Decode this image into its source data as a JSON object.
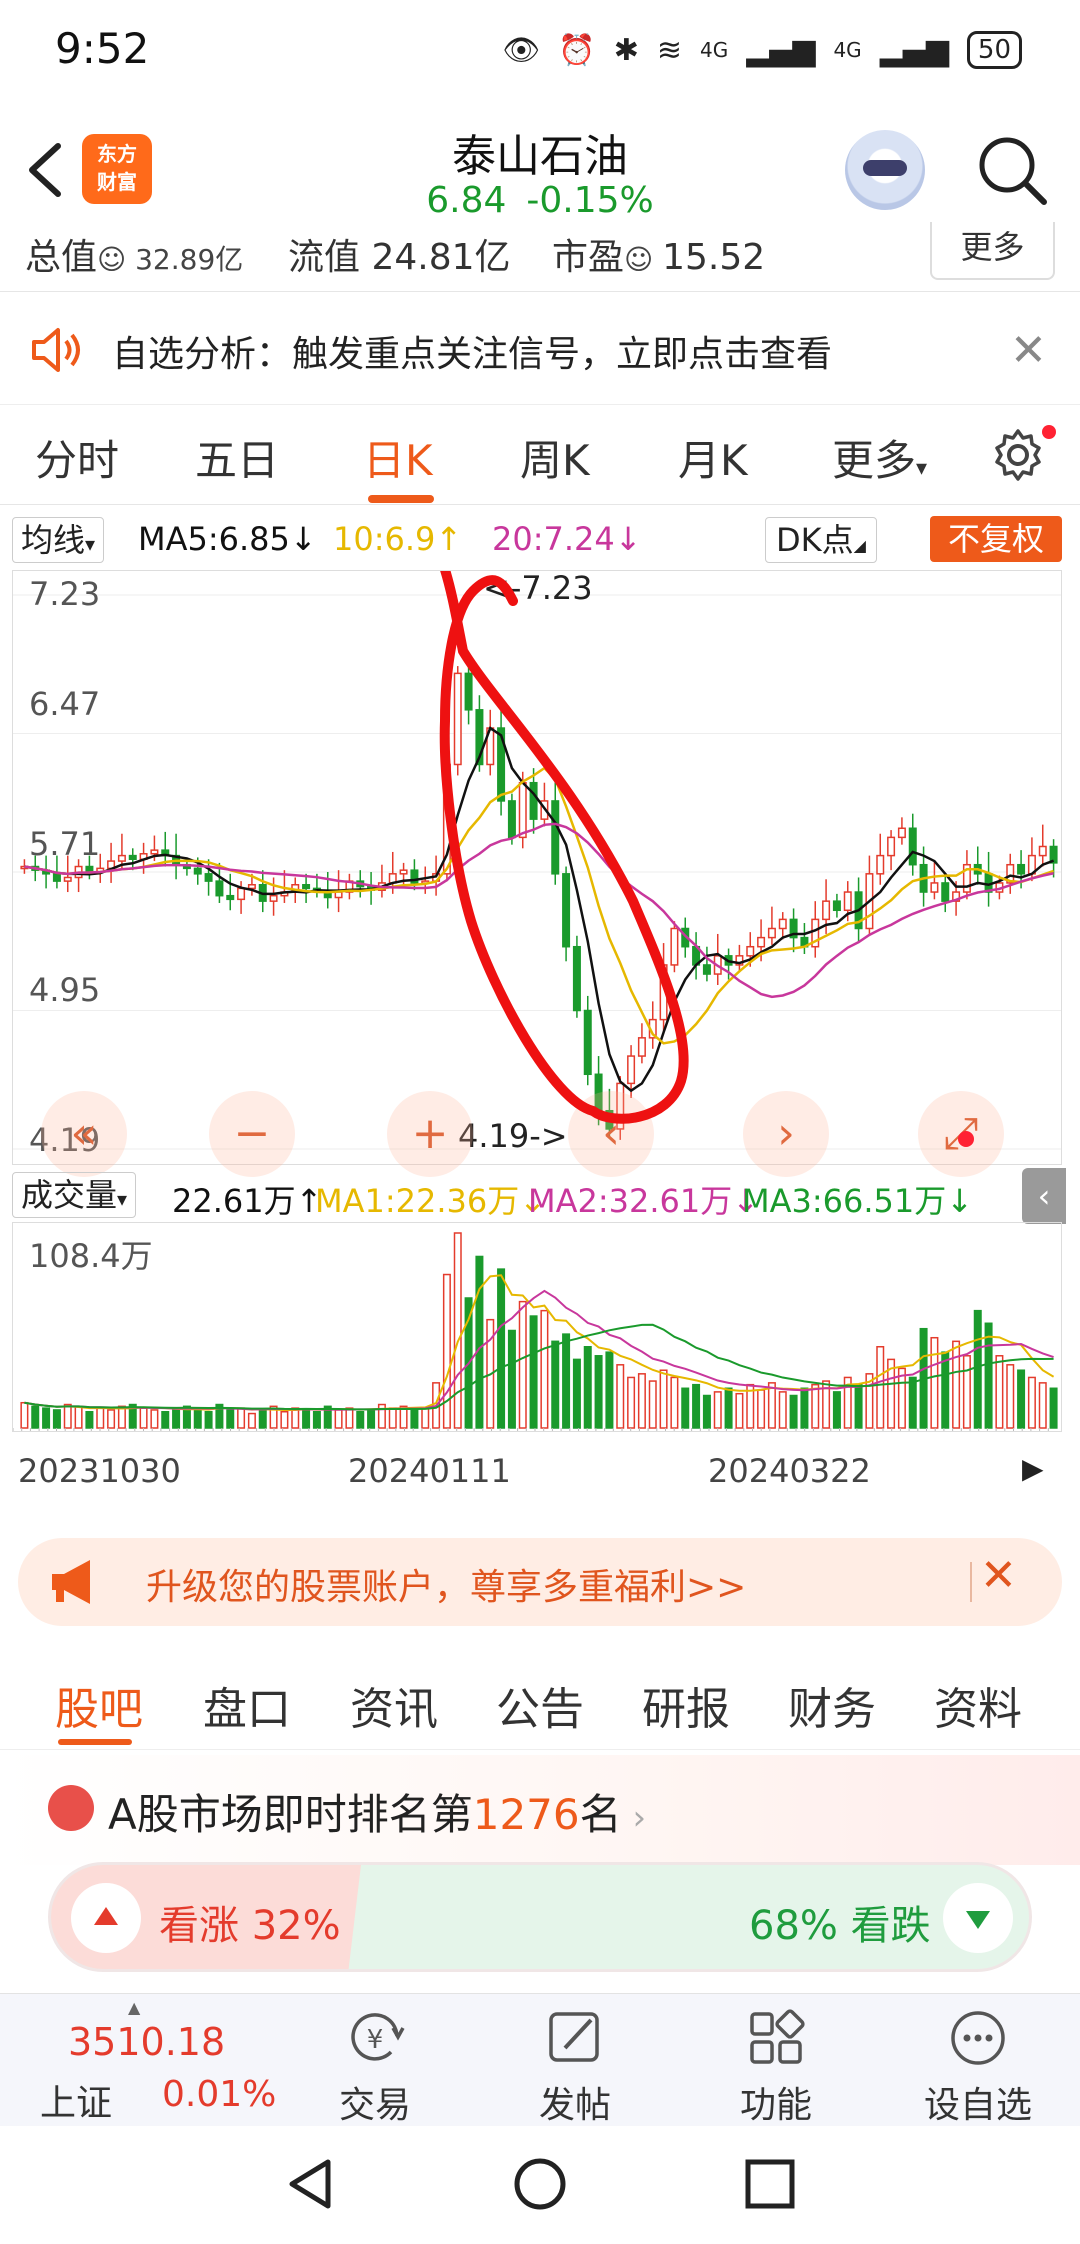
{
  "status_bar": {
    "time": "9:52",
    "network_1": "4G",
    "network_2": "4G",
    "battery": "50"
  },
  "header": {
    "logo_line1": "东方",
    "logo_line2": "财富",
    "stock_name": "泰山石油",
    "price": "6.84",
    "change": "-0.15%"
  },
  "metrics": {
    "total_label": "总值",
    "total_value": "32.89亿",
    "float_label": "流值",
    "float_value": "24.81亿",
    "pe_label": "市盈",
    "pe_value": "15.52",
    "more": "更多"
  },
  "alert": {
    "text": "自选分析：触发重点关注信号，立即点击查看"
  },
  "chart_tabs": [
    "分时",
    "五日",
    "日K",
    "周K",
    "月K",
    "更多"
  ],
  "ma_row": {
    "selector": "均线",
    "ma5": "MA5:6.85",
    "ma10": "10:6.9",
    "ma20": "20:7.24",
    "dk": "DK点",
    "adjust": "不复权"
  },
  "colors": {
    "accent": "#ee5a1a",
    "up": "#e43b2c",
    "down": "#1a9a2c",
    "ma5": "#111111",
    "ma10": "#e6b800",
    "ma20": "#c8379c",
    "annotation": "#ee1111"
  },
  "chart_data": {
    "type": "candlestick",
    "y_ticks": [
      "7.23",
      "6.47",
      "5.71",
      "4.95",
      "4.19"
    ],
    "ylim": [
      4.19,
      7.23
    ],
    "max_label": "<-7.23",
    "min_label": "4.19->",
    "x_labels": [
      "20231030",
      "20240111",
      "20240322"
    ],
    "close": [
      5.74,
      5.72,
      5.7,
      5.66,
      5.68,
      5.74,
      5.71,
      5.73,
      5.77,
      5.8,
      5.78,
      5.81,
      5.83,
      5.8,
      5.75,
      5.73,
      5.7,
      5.66,
      5.58,
      5.56,
      5.62,
      5.64,
      5.55,
      5.58,
      5.6,
      5.64,
      5.62,
      5.61,
      5.57,
      5.6,
      5.66,
      5.63,
      5.61,
      5.65,
      5.7,
      5.72,
      5.65,
      5.66,
      5.7,
      6.3,
      6.8,
      6.6,
      6.3,
      6.5,
      6.1,
      5.9,
      6.2,
      6.0,
      6.1,
      5.7,
      5.3,
      4.95,
      4.6,
      4.4,
      4.3,
      4.55,
      4.7,
      4.8,
      4.9,
      5.2,
      5.4,
      5.3,
      5.2,
      5.15,
      5.25,
      5.2,
      5.25,
      5.3,
      5.35,
      5.4,
      5.45,
      5.35,
      5.3,
      5.45,
      5.55,
      5.5,
      5.6,
      5.4,
      5.7,
      5.8,
      5.9,
      5.95,
      5.75,
      5.6,
      5.65,
      5.55,
      5.6,
      5.75,
      5.7,
      5.6,
      5.65,
      5.75,
      5.7,
      5.8,
      5.85,
      5.76
    ],
    "volume": {
      "label": "成交量",
      "current": "22.61万",
      "ma1": "MA1:22.36万",
      "ma2": "MA2:32.61万",
      "ma3": "MA3:66.51万",
      "y_max_label": "108.4万",
      "values": [
        14,
        12,
        11,
        10,
        13,
        12,
        9,
        11,
        10,
        12,
        13,
        11,
        10,
        9,
        10,
        12,
        11,
        9,
        13,
        10,
        11,
        8,
        10,
        12,
        9,
        11,
        10,
        9,
        12,
        10,
        11,
        9,
        10,
        13,
        11,
        12,
        10,
        11,
        25,
        85,
        108,
        72,
        95,
        60,
        88,
        54,
        70,
        62,
        65,
        48,
        52,
        38,
        45,
        40,
        42,
        35,
        28,
        30,
        26,
        32,
        28,
        22,
        24,
        18,
        20,
        22,
        19,
        24,
        21,
        25,
        20,
        18,
        22,
        24,
        26,
        20,
        28,
        24,
        30,
        45,
        38,
        33,
        28,
        55,
        50,
        42,
        48,
        40,
        65,
        58,
        40,
        35,
        32,
        28,
        25,
        22
      ]
    }
  },
  "chart_controls": [
    "«",
    "−",
    "+",
    "‹",
    "›",
    "⤢"
  ],
  "promo": {
    "text": "升级您的股票账户，尊享多重福利>>"
  },
  "bottom_tabs": [
    "股吧",
    "盘口",
    "资讯",
    "公告",
    "研报",
    "财务",
    "资料"
  ],
  "ranking": {
    "prefix": "A股市场即时排名第",
    "number": "1276",
    "suffix": "名"
  },
  "vote": {
    "up": "看涨 32%",
    "down": "68% 看跌",
    "up_fraction": 0.32
  },
  "bottom_nav": {
    "index_value": "3510.18",
    "index_name": "上证",
    "index_change": "0.01%",
    "items": [
      "交易",
      "发帖",
      "功能",
      "设自选"
    ]
  }
}
